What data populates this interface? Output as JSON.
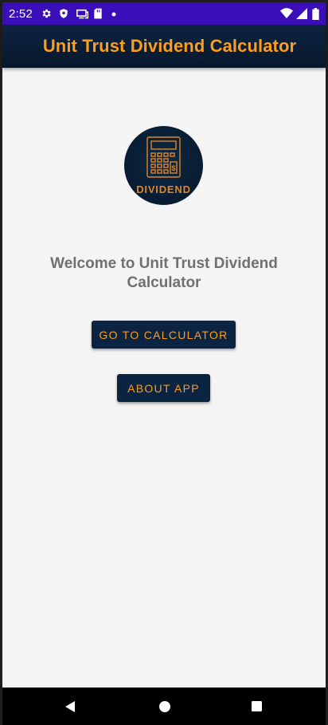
{
  "status_bar": {
    "time": "2:52",
    "left_icons": [
      "settings-icon",
      "shield-icon",
      "cast-icon",
      "sd-card-icon",
      "dot-icon"
    ],
    "right_icons": [
      "wifi-icon",
      "signal-icon",
      "battery-icon"
    ],
    "background": "#3a0eb8"
  },
  "app_bar": {
    "title": "Unit Trust Dividend Calculator",
    "title_color": "#ff9d1a",
    "background": "#0c2340"
  },
  "main": {
    "logo": {
      "icon": "calculator-dollar-icon",
      "label": "DIVIDEND"
    },
    "welcome_text": "Welcome to Unit Trust Dividend Calculator",
    "buttons": {
      "calculator": "GO TO CALCULATOR",
      "about": "ABOUT APP"
    },
    "accent_color": "#ff9d1a",
    "button_bg": "#0b2441"
  },
  "nav_bar": {
    "items": [
      "back-icon",
      "home-icon",
      "recents-icon"
    ]
  }
}
